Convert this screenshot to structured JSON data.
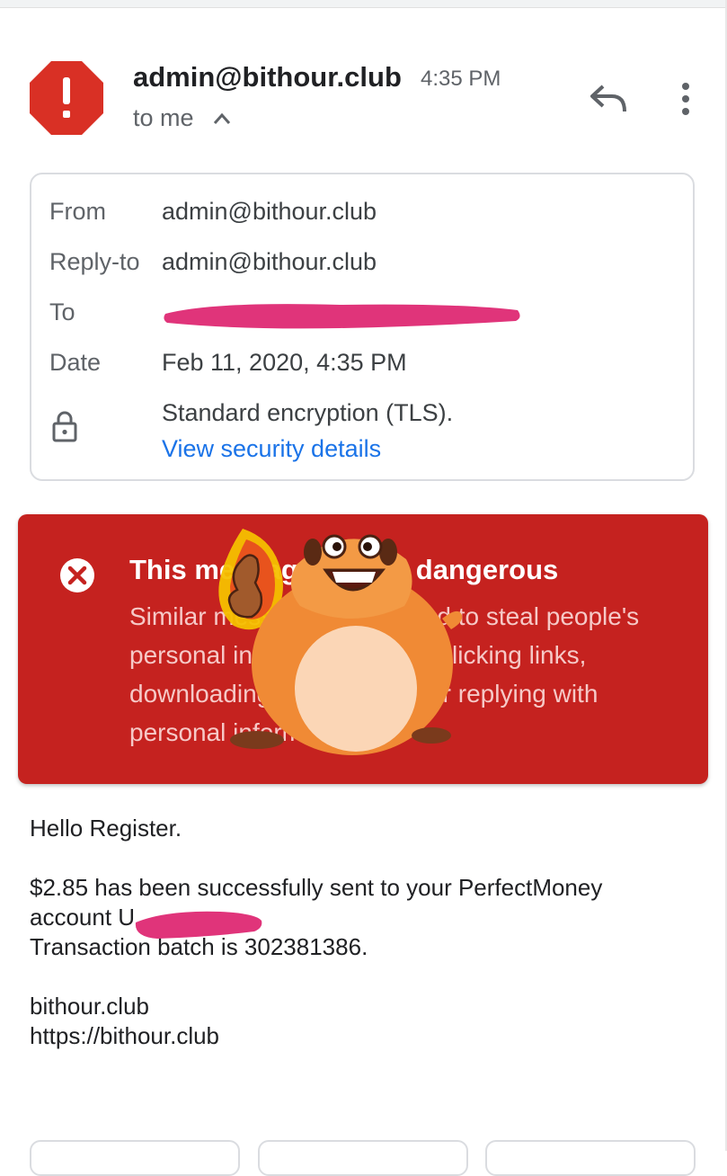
{
  "header": {
    "sender": "admin@bithour.club",
    "time": "4:35 PM",
    "to_line": "to me"
  },
  "details": {
    "from_label": "From",
    "from_value": "admin@bithour.club",
    "replyto_label": "Reply-to",
    "replyto_value": "admin@bithour.club",
    "to_label": "To",
    "date_label": "Date",
    "date_value": "Feb 11, 2020, 4:35 PM",
    "encryption_text": "Standard encryption (TLS).",
    "security_link": "View security details"
  },
  "warning": {
    "title": "This message seems dangerous",
    "body_lines": [
      "Similar messages were used to steal people's",
      "personal information. Avoid clicking links,",
      "downloading attachments, or replying with",
      "personal information."
    ]
  },
  "message": {
    "greeting": "Hello Register.",
    "line1": "$2.85 has been successfully sent to your PerfectMoney",
    "line2": "account U",
    "line3": "Transaction batch is 302381386.",
    "signature_name": "bithour.club",
    "signature_url": "https://bithour.club"
  },
  "colors": {
    "warning_red": "#c5221f",
    "avatar_red": "#d93025",
    "link_blue": "#1a73e8",
    "redaction_pink": "#e0347a"
  },
  "icons": [
    "alert-octagon-icon",
    "chevron-up-icon",
    "reply-icon",
    "more-vert-icon",
    "lock-icon",
    "error-circle-icon"
  ]
}
